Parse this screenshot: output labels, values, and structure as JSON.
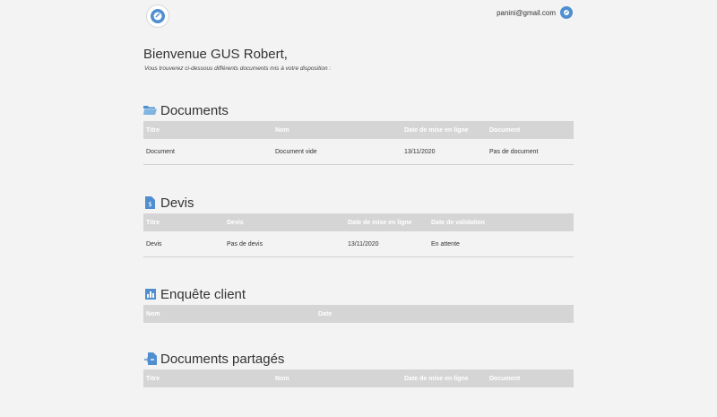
{
  "header": {
    "email": "panini@gmail.com"
  },
  "welcome": {
    "title": "Bienvenue GUS Robert,",
    "subtitle": "Vous trouverez ci-dessous différents documents mis à votre disposition :"
  },
  "documents": {
    "title": "Documents",
    "columns": [
      "Titre",
      "Nom",
      "Date de mise en ligne",
      "Document"
    ],
    "rows": [
      [
        "Document",
        "Document vide",
        "13/11/2020",
        "Pas de document"
      ]
    ]
  },
  "devis": {
    "title": "Devis",
    "columns": [
      "Titre",
      "Devis",
      "Date de mise en ligne",
      "Date de validation"
    ],
    "rows": [
      [
        "Devis",
        "Pas de devis",
        "13/11/2020",
        "En attente"
      ]
    ]
  },
  "enquete": {
    "title": "Enquête client",
    "columns": [
      "Nom",
      "Date"
    ]
  },
  "partages": {
    "title": "Documents partagés",
    "columns": [
      "Titre",
      "Nom",
      "Date de mise en ligne",
      "Document"
    ]
  },
  "colors": {
    "header_bg": "#d5d5d5",
    "icon_blue": "#4f8fd0",
    "page_bg": "#f3f3f3"
  },
  "icons": {
    "logo": "logo-icon",
    "user": "user-icon",
    "documents": "folder-icon",
    "devis": "invoice-icon",
    "enquete": "bar-chart-icon",
    "partages": "shared-file-icon"
  }
}
